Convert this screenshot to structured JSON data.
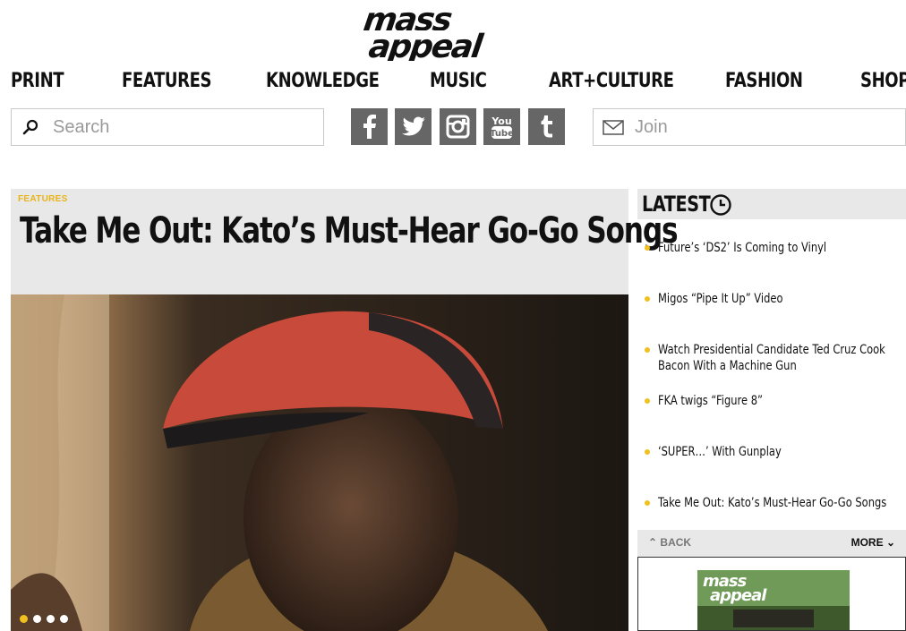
{
  "site": {
    "logo_text": "mass appeal"
  },
  "nav": {
    "items": [
      "PRINT",
      "FEATURES",
      "KNOWLEDGE",
      "MUSIC",
      "ART+CULTURE",
      "FASHION",
      "SHOP"
    ]
  },
  "search": {
    "placeholder": "Search"
  },
  "social": {
    "icons": [
      "facebook-icon",
      "twitter-icon",
      "instagram-icon",
      "youtube-icon",
      "tumblr-icon"
    ]
  },
  "join": {
    "placeholder": "Join"
  },
  "feature": {
    "kicker": "FEATURES",
    "title": "Take Me Out: Kato’s Must-Hear Go-Go Songs",
    "slides_total": 4,
    "active_slide": 1
  },
  "latest": {
    "title": "LATEST",
    "items": [
      "Future’s ‘DS2’ Is Coming to Vinyl",
      "Migos “Pipe It Up” Video",
      "Watch Presidential Candidate Ted Cruz Cook Bacon With a Machine Gun",
      "FKA twigs “Figure 8”",
      "‘SUPER…’ With Gunplay",
      "Take Me Out: Kato’s Must-Hear Go-Go Songs"
    ],
    "back_label": "BACK",
    "more_label": "MORE"
  },
  "colors": {
    "accent": "#f0c020",
    "social_bg": "#666666",
    "panel_bg": "#e8e8e8"
  }
}
